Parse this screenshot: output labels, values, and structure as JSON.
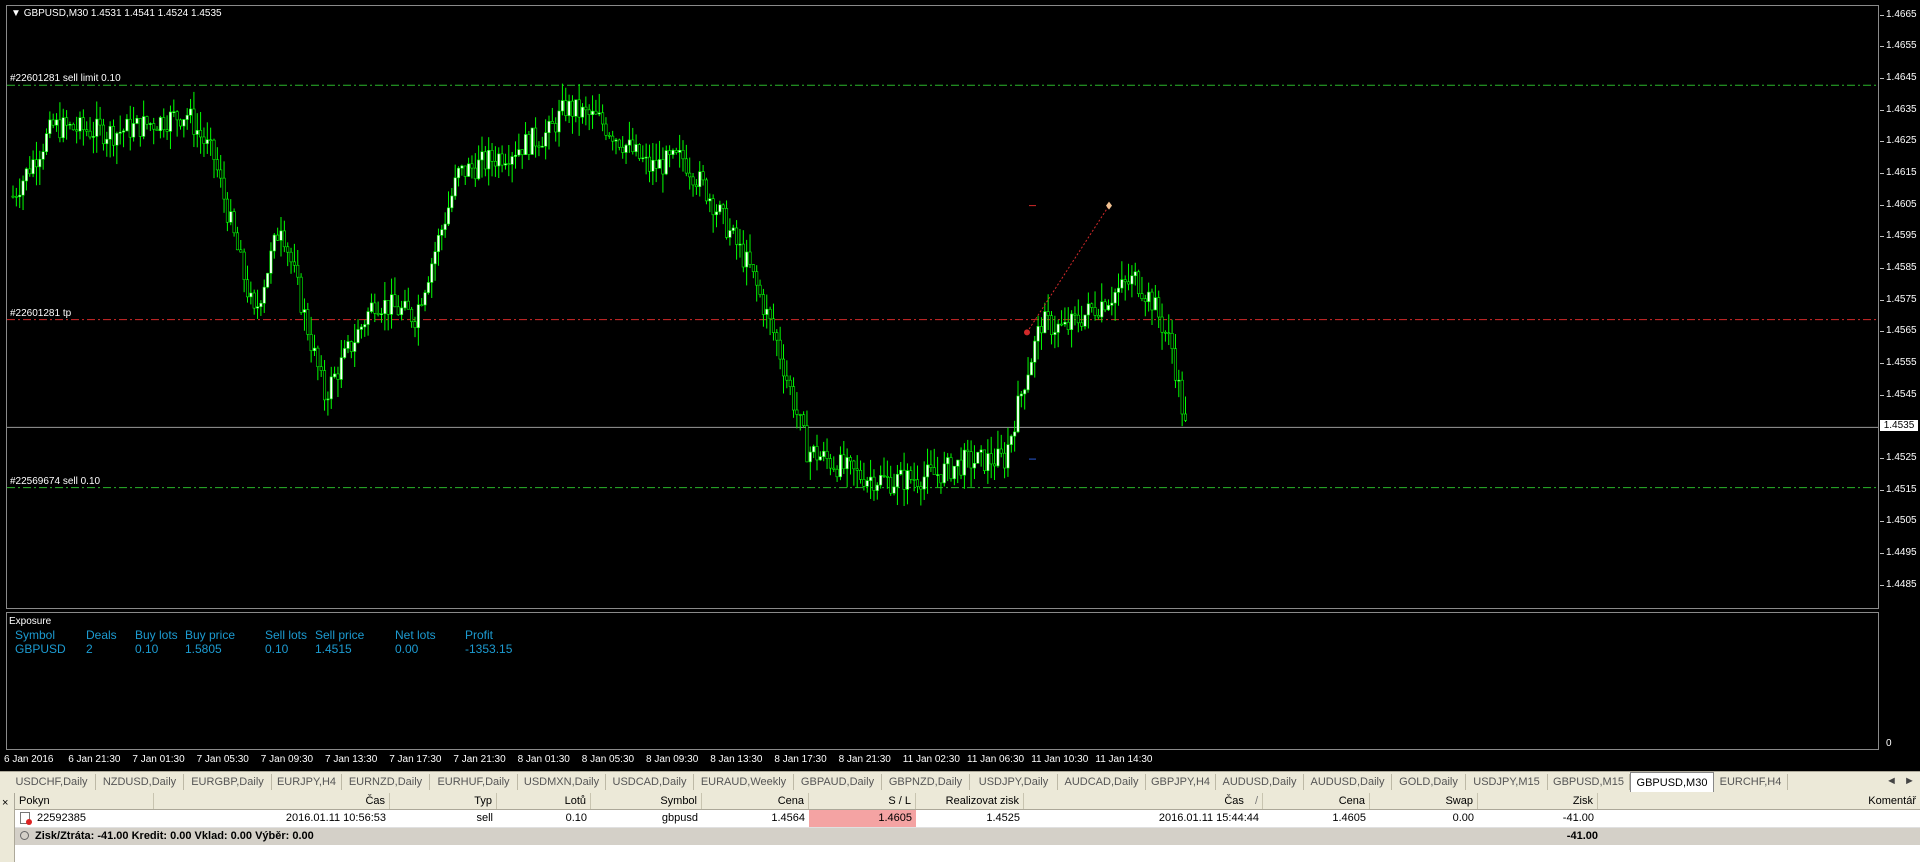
{
  "chart": {
    "header": "GBPUSD,M30  1.4531 1.4541 1.4524 1.4535",
    "header_arrow_icon": "triangle-down-icon",
    "y_range": [
      1.4478,
      1.4668
    ],
    "price_labels": [
      "1.4665",
      "1.4655",
      "1.4645",
      "1.4635",
      "1.4625",
      "1.4615",
      "1.4605",
      "1.4595",
      "1.4585",
      "1.4575",
      "1.4565",
      "1.4555",
      "1.4545",
      "1.4535",
      "1.4525",
      "1.4515",
      "1.4505",
      "1.4495",
      "1.4485"
    ],
    "current_price": "1.4535",
    "order_lines": [
      {
        "label": "#22601281 sell limit 0.10",
        "price": 1.4643,
        "color": "#2ab52a"
      },
      {
        "label": "#22601281 tp",
        "price": 1.4569,
        "color": "#d22a2a"
      },
      {
        "label": "#22569674 sell 0.10",
        "price": 1.4516,
        "color": "#2ab52a"
      }
    ],
    "candle_color": "#00ff00",
    "bull_body_color": "#ffffff",
    "bear_body_color": "#000000",
    "trade_arrow": {
      "from_price": 1.4565,
      "to_price": 1.4605,
      "color": "#d22a2a"
    }
  },
  "exposure": {
    "title": "Exposure",
    "color": "#1c9bd1",
    "headers": [
      "Symbol",
      "Deals",
      "Buy lots",
      "Buy price",
      "Sell lots",
      "Sell price",
      "Net lots",
      "Profit"
    ],
    "row": [
      "GBPUSD",
      "2",
      "0.10",
      "1.5805",
      "0.10",
      "1.4515",
      "0.00",
      "-1353.15"
    ]
  },
  "sub_axis_label": "0",
  "time_labels": [
    "6 Jan 2016",
    "6 Jan 21:30",
    "7 Jan 01:30",
    "7 Jan 05:30",
    "7 Jan 09:30",
    "7 Jan 13:30",
    "7 Jan 17:30",
    "7 Jan 21:30",
    "8 Jan 01:30",
    "8 Jan 05:30",
    "8 Jan 09:30",
    "8 Jan 13:30",
    "8 Jan 17:30",
    "8 Jan 21:30",
    "11 Jan 02:30",
    "11 Jan 06:30",
    "11 Jan 10:30",
    "11 Jan 14:30"
  ],
  "tabs": [
    "USDCHF,Daily",
    "NZDUSD,Daily",
    "EURGBP,Daily",
    "EURJPY,H4",
    "EURNZD,Daily",
    "EURHUF,Daily",
    "USDMXN,Daily",
    "USDCAD,Daily",
    "EURAUD,Weekly",
    "GBPAUD,Daily",
    "GBPNZD,Daily",
    "USDJPY,Daily",
    "AUDCAD,Daily",
    "GBPJPY,H4",
    "AUDUSD,Daily",
    "AUDUSD,Daily",
    "GOLD,Daily",
    "USDJPY,M15",
    "GBPUSD,M15",
    "GBPUSD,M30",
    "EURCHF,H4"
  ],
  "active_tab": "GBPUSD,M30",
  "tab_nav": {
    "left_icon": "◄",
    "right_icon": "►"
  },
  "terminal": {
    "close_icon": "×",
    "headers": [
      "Pokyn",
      "Čas",
      "Typ",
      "Lotů",
      "Symbol",
      "Cena",
      "S / L",
      "Realizovat zisk",
      "Čas",
      "Cena",
      "Swap",
      "Zisk",
      "Komentář"
    ],
    "sort_indicator": "/",
    "order": {
      "ticket": "22592385",
      "open_time": "2016.01.11 10:56:53",
      "type": "sell",
      "lots": "0.10",
      "symbol": "gbpusd",
      "open_price": "1.4564",
      "sl": "1.4605",
      "tp": "1.4525",
      "time": "2016.01.11 15:44:44",
      "price": "1.4605",
      "swap": "0.00",
      "profit": "-41.00",
      "comment": ""
    },
    "summary": {
      "text": "Zisk/Ztráta: -41.00  Kredit: 0.00  Vklad: 0.00  Výběr: 0.00",
      "profit": "-41.00"
    }
  }
}
